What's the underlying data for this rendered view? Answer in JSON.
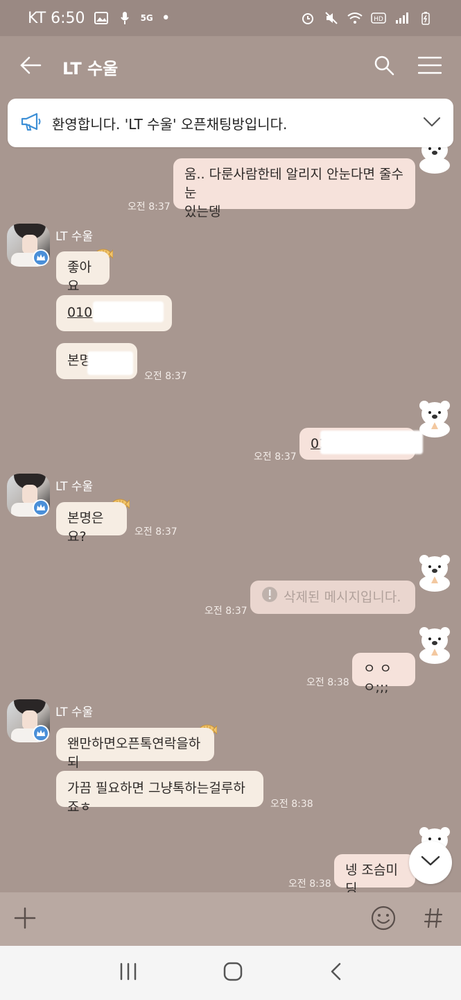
{
  "status": {
    "carrier_time": "KT 6:50",
    "network": "5G",
    "dot": "•"
  },
  "header": {
    "title": "LT 수울"
  },
  "notice": {
    "text": "환영합니다. 'LT 수울' 오픈채팅방입니다."
  },
  "messages": {
    "m1": {
      "text_line1": "움.. 다룬사람한테 알리지 안눈다면 줄수눈",
      "text_line2": "있는뎅",
      "time": "오전 8:37"
    },
    "sender1": "LT 수울",
    "m2": {
      "text": "좋아요"
    },
    "m3": {
      "text": "010"
    },
    "m4": {
      "text": "본명",
      "time": "오전 8:37"
    },
    "m5": {
      "text": "01",
      "time": "오전 8:37"
    },
    "sender2": "LT 수울",
    "m6": {
      "text": "본명은요?",
      "time": "오전 8:37"
    },
    "m7": {
      "text": "삭제된 메시지입니다.",
      "time": "오전 8:37"
    },
    "m8": {
      "text": "ㅇ ㅇㅇ;;;",
      "time": "오전 8:38"
    },
    "sender3": "LT 수울",
    "m9": {
      "text": "왠만하면오픈톡연락을하되"
    },
    "m10": {
      "text": "가끔 필요하면 그냥톡하는걸루하죠ㅎ",
      "time": "오전 8:38"
    },
    "m11": {
      "text": "넹 조슴미딩",
      "time": "오전 8:38"
    }
  },
  "icons": {
    "back": "back-arrow-icon",
    "search": "search-icon",
    "menu": "menu-icon",
    "megaphone": "megaphone-icon",
    "chevron": "chevron-down-icon",
    "plus": "plus-icon",
    "emoji": "emoji-icon",
    "hash": "hash-icon"
  },
  "colors": {
    "background": "#a89790",
    "bubble_me": "#f6e2db",
    "bubble_other": "#f6ede3",
    "status_bar": "#9a8983",
    "input_bar": "#b9a9a2",
    "badge_blue": "#4a8fd8"
  }
}
